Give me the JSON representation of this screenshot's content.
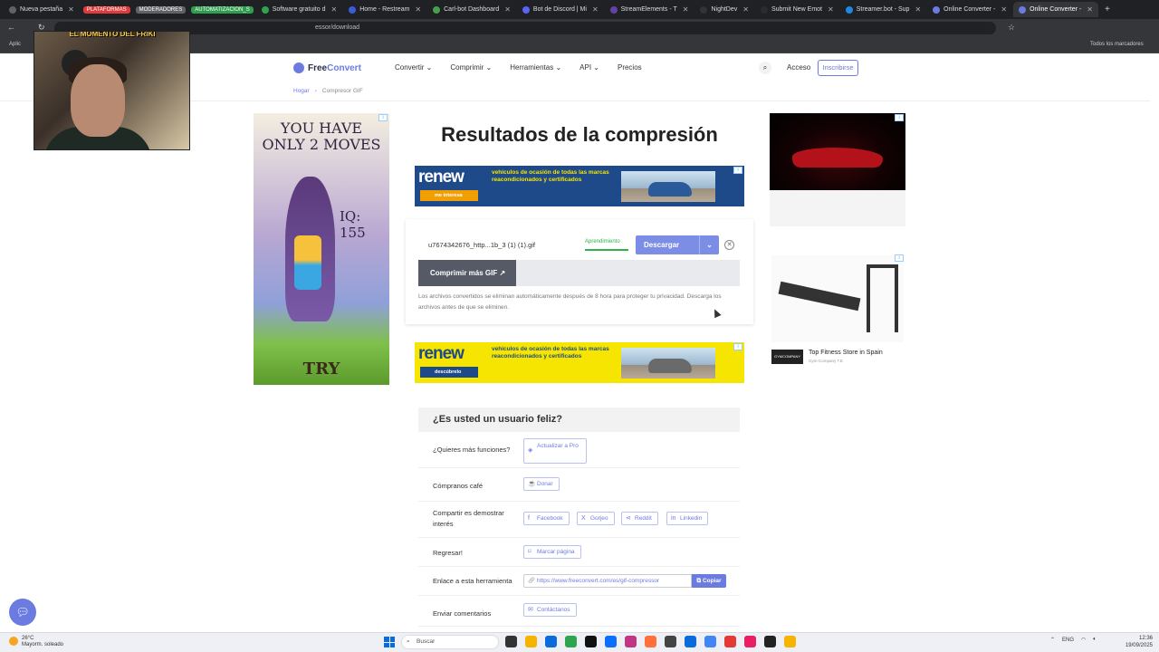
{
  "browser": {
    "tabs": [
      {
        "label": "Nueva pestaña",
        "color": "#5f6368"
      },
      {
        "label": "Software gratuito d",
        "color": "#2ea44f"
      },
      {
        "label": "Home - Restream",
        "color": "#3b5bdb"
      },
      {
        "label": "Carl-bot Dashboard",
        "color": "#45a049"
      },
      {
        "label": "Bot de Discord | Mi",
        "color": "#5865f2"
      },
      {
        "label": "StreamElements - T",
        "color": "#6441a5"
      },
      {
        "label": "NightDev",
        "color": "#333"
      },
      {
        "label": "Submit New Emot",
        "color": "#2b2b2b"
      },
      {
        "label": "Streamer.bot - Sup",
        "color": "#1e88e5"
      },
      {
        "label": "Online Converter -",
        "color": "#6c7be0"
      },
      {
        "label": "Online Converter -",
        "color": "#6c7be0",
        "active": true
      }
    ],
    "tab_groups": [
      {
        "label": "PLATAFORMAS",
        "color": "#e03b3b"
      },
      {
        "label": "MODERADORES",
        "color": "#5f6368"
      },
      {
        "label": "AUTOMATIZACION_S",
        "color": "#2e9e4f"
      }
    ],
    "address": "essor/download",
    "bookmarks_right": "Todos los marcadores",
    "bookmarks_left": "Aplic"
  },
  "webcam": {
    "overlay_text": "EL MOMENTO DEL FRIKI"
  },
  "header": {
    "logo_part1": "Free",
    "logo_part2": "Convert",
    "nav": [
      "Convertir ⌄",
      "Comprimir ⌄",
      "Herramientas ⌄",
      "API ⌄",
      "Precios"
    ],
    "login": "Acceso",
    "signup": "Inscribirse"
  },
  "breadcrumb": {
    "home": "Hogar",
    "current": "Compresor GIF"
  },
  "ads": {
    "left": {
      "headline_1": "YOU HAVE",
      "headline_2": "ONLY 2 MOVES",
      "iq": "IQ: 155",
      "cta": "TRY"
    },
    "banner1": {
      "brand": "renew",
      "tagline": "vehículos de ocasión de todas las marcas reacondicionados y certificados",
      "cta": "me interesa"
    },
    "banner2": {
      "brand": "renew",
      "tagline": "vehículos de ocasión de todas las marcas reacondicionados y certificados",
      "cta": "descúbrelo"
    },
    "right_mid": {
      "title": "Top Fitness Store in Spain",
      "subtitle": "Gym-Company T.E"
    }
  },
  "main": {
    "title": "Resultados de la compresión",
    "filename": "u7674342676_http...1b_3 (1) (1).gif",
    "status": "Aprendimiento",
    "download": "Descargar",
    "compress_more": "Comprimir más GIF",
    "note": "Los archivos convertidos se eliminan automáticamente después de 8 hora para proteger tu privacidad. Descarga los archivos antes de que se eliminen."
  },
  "happy": {
    "title": "¿Es usted un usuario feliz?",
    "rows": {
      "more_features": {
        "label": "¿Quieres más funciones?",
        "button": "Actualizar a Pro"
      },
      "coffee": {
        "label": "Cómpranos café",
        "button": "Donar"
      },
      "share": {
        "label": "Compartir es demostrar interés",
        "buttons": [
          "Facebook",
          "Gorjeo",
          "Reddit",
          "Linkedin"
        ]
      },
      "back": {
        "label": "Regresar!",
        "button": "Marcar página"
      },
      "link": {
        "label": "Enlace a esta herramienta",
        "url": "https://www.freeconvert.com/es/gif-compressor",
        "copy": "Copiar"
      },
      "feedback": {
        "label": "Enviar comentarios",
        "button": "Contáctanos"
      }
    }
  },
  "taskbar": {
    "weather_temp": "26°C",
    "weather_desc": "Mayorm. soleado",
    "search": "Buscar",
    "lang": "ENG",
    "time": "12:36",
    "date": "19/09/2025",
    "app_colors": [
      "#333",
      "#f4b400",
      "#0a6cdc",
      "#2ea44f",
      "#111",
      "#0d6efd",
      "#c13584",
      "#ff7139",
      "#444",
      "#0a6cdc",
      "#4285f4",
      "#e53935",
      "#e91e63",
      "#222",
      "#f4b400"
    ]
  }
}
